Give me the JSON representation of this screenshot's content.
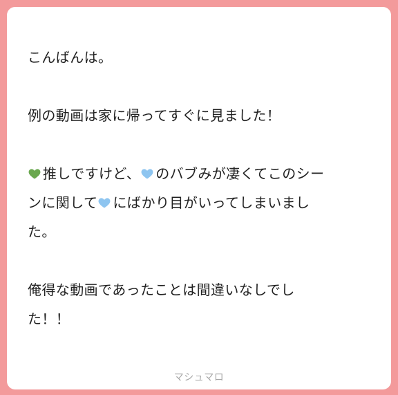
{
  "colors": {
    "background": "#f39a9b",
    "card": "#ffffff",
    "text": "#222222",
    "footer_text": "#a6a6a6",
    "green_heart": "#6aa84f",
    "blue_heart": "#8ec5f0"
  },
  "message": {
    "line1": "こんばんは。",
    "line2": "例の動画は家に帰ってすぐに見ました！",
    "line3_icon": "green-heart",
    "line3_a": "推しですけど、",
    "line3_icon2": "blue-heart",
    "line3_b": "のバブみが凄くてこのシー",
    "line4_a": "ンに関して",
    "line4_icon": "blue-heart",
    "line4_b": "にばかり目がいってしまいまし",
    "line5": "た。",
    "line6": "俺得な動画であったことは間違いなしでし",
    "line7": "た！！"
  },
  "footer": {
    "brand": "マシュマロ"
  }
}
